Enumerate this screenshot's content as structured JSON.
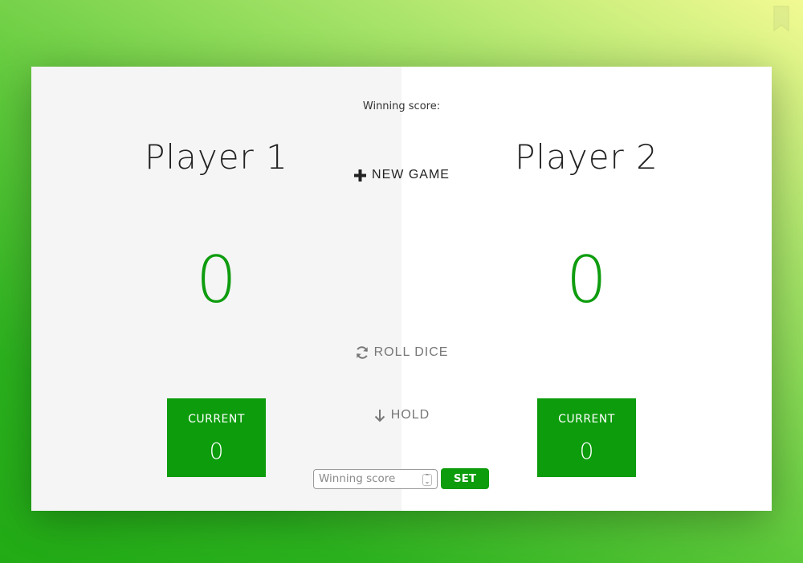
{
  "game": {
    "winning_label": "Winning score:",
    "buttons": {
      "new_game": "NEW GAME",
      "roll_dice": "ROLL DICE",
      "hold": "HOLD",
      "set": "SET"
    },
    "winning_input": {
      "placeholder": "Winning score",
      "value": ""
    }
  },
  "players": [
    {
      "name": "Player 1",
      "score": "0",
      "current_label": "CURRENT",
      "current_score": "0"
    },
    {
      "name": "Player 2",
      "score": "0",
      "current_label": "CURRENT",
      "current_score": "0"
    }
  ],
  "colors": {
    "accent": "#0c9c0c",
    "panel_left": "#f5f5f5",
    "panel_right": "#ffffff"
  },
  "icons": {
    "new_game": "plus-icon",
    "roll_dice": "refresh-icon",
    "hold": "arrow-down-icon",
    "stepper": "stepper-icon"
  }
}
